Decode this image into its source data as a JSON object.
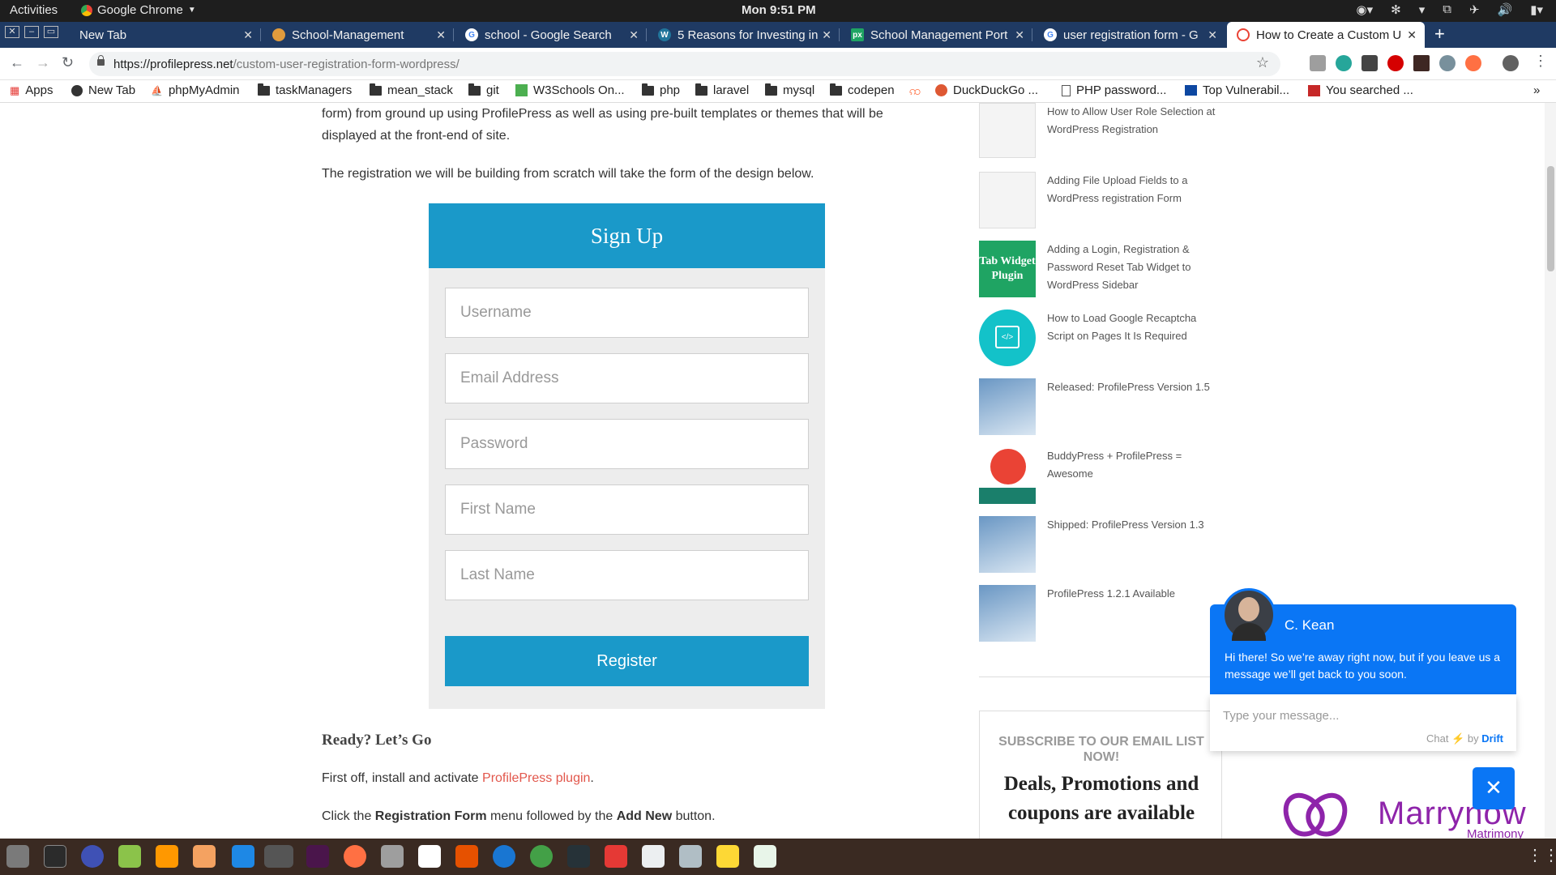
{
  "system_bar": {
    "activities": "Activities",
    "app_name": "Google Chrome",
    "clock": "Mon  9:51 PM"
  },
  "tabs": [
    {
      "title": "New Tab",
      "favicon_color": "#1f3a63"
    },
    {
      "title": "School-Management",
      "favicon_color": "#e09b3d"
    },
    {
      "title": "school - Google Search",
      "favicon_color": "#4285f4"
    },
    {
      "title": "5 Reasons for Investing in",
      "favicon_color": "#21759b"
    },
    {
      "title": "School Management Port",
      "favicon_color": "#1fa463"
    },
    {
      "title": "user registration form - G",
      "favicon_color": "#4285f4"
    },
    {
      "title": "How to Create a Custom U",
      "favicon_color": "#ea4335"
    }
  ],
  "omnibox": {
    "host": "https://profilepress.net",
    "path": "/custom-user-registration-form-wordpress/"
  },
  "bookmarks": [
    {
      "label": "Apps",
      "icon": "apps-grid-icon"
    },
    {
      "label": "New Tab",
      "icon": "page-icon"
    },
    {
      "label": "phpMyAdmin",
      "icon": "phpmyadmin-icon"
    },
    {
      "label": "taskManagers",
      "icon": "folder-icon"
    },
    {
      "label": "mean_stack",
      "icon": "folder-icon"
    },
    {
      "label": "git",
      "icon": "folder-icon"
    },
    {
      "label": "W3Schools On...",
      "icon": "w3schools-icon"
    },
    {
      "label": "php",
      "icon": "folder-icon"
    },
    {
      "label": "laravel",
      "icon": "folder-icon"
    },
    {
      "label": "mysql",
      "icon": "folder-icon"
    },
    {
      "label": "codepen",
      "icon": "folder-icon"
    },
    {
      "label": "DuckDuckGo ...",
      "icon": "duckduckgo-icon"
    },
    {
      "label": "PHP password...",
      "icon": "page-icon"
    },
    {
      "label": "Top Vulnerabil...",
      "icon": "flag-icon"
    },
    {
      "label": "You searched ...",
      "icon": "book-icon"
    }
  ],
  "article": {
    "intro_line1": "form) from ground up using ProfilePress as well as using pre-built templates or themes that will be",
    "intro_line2": "displayed at the front-end of site.",
    "para2": "The registration we will be building from scratch will take the form of the design below.",
    "heading": "Ready? Let’s Go",
    "step1_prefix": "First off, install and activate ",
    "step1_link": "ProfilePress plugin",
    "step1_suffix": ".",
    "step2_a": "Click the ",
    "step2_b": "Registration Form",
    "step2_c": " menu followed by the ",
    "step2_d": "Add New",
    "step2_e": " button."
  },
  "signup_form": {
    "title": "Sign Up",
    "fields": [
      "Username",
      "Email Address",
      "Password",
      "First Name",
      "Last Name"
    ],
    "button": "Register"
  },
  "sidebar": {
    "posts": [
      "How to Allow User Role Selection at WordPress Registration",
      "Adding File Upload Fields to a WordPress registration Form",
      "Adding a Login, Registration & Password Reset Tab Widget to WordPress Sidebar",
      "How to Load Google Recaptcha Script on Pages It Is Required",
      "Released: ProfilePress Version 1.5",
      "BuddyPress + ProfilePress = Awesome",
      "Shipped: ProfilePress Version 1.3",
      "ProfilePress 1.2.1 Available"
    ],
    "thumb_tab_widget_line1": "Tab Widget",
    "thumb_tab_widget_line2": "Plugin",
    "subscribe_title": "SUBSCRIBE TO OUR EMAIL LIST NOW!",
    "subscribe_subtitle_line1": "Deals, Promotions and",
    "subscribe_subtitle_line2": "coupons are available"
  },
  "chat": {
    "agent": "C. Kean",
    "message": "Hi there! So we’re away right now, but if you leave us a message we’ll get back to you soon.",
    "input_placeholder": "Type your message...",
    "brand_prefix": "Chat",
    "brand_by": "by",
    "brand_name": "Drift",
    "accent": "#0a76f5"
  },
  "ad": {
    "brand": "Marrynow",
    "sub": "Matrimony"
  },
  "colors": {
    "tab_strip": "#1f3a63",
    "form_blue": "#1a99c9",
    "link": "#e2574c"
  }
}
